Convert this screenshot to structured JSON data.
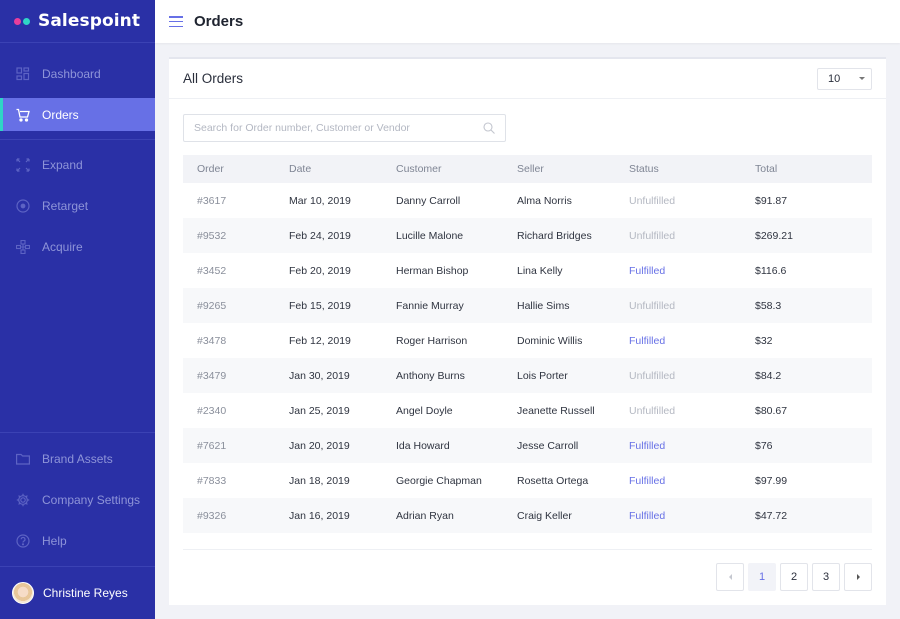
{
  "app": {
    "name": "Salespoint",
    "logo_dot_colors": [
      "#e83e9c",
      "#2fd5c6"
    ]
  },
  "colors": {
    "sidebar_bg": "#2a30a6",
    "accent": "#6770e6",
    "active_indicator": "#2fd5c6",
    "fulfilled": "#6770e6",
    "unfulfilled": "#b4b8c2"
  },
  "sidebar": {
    "top_items": [
      {
        "label": "Dashboard",
        "icon": "grid-icon",
        "active": false
      },
      {
        "label": "Orders",
        "icon": "cart-icon",
        "active": true
      }
    ],
    "mid_items": [
      {
        "label": "Expand",
        "icon": "expand-icon"
      },
      {
        "label": "Retarget",
        "icon": "target-icon"
      },
      {
        "label": "Acquire",
        "icon": "network-icon"
      }
    ],
    "bottom_items": [
      {
        "label": "Brand Assets",
        "icon": "folder-icon"
      },
      {
        "label": "Company Settings",
        "icon": "gear-icon"
      },
      {
        "label": "Help",
        "icon": "help-icon"
      }
    ],
    "user": {
      "name": "Christine Reyes"
    }
  },
  "header": {
    "title": "Orders"
  },
  "card": {
    "title": "All Orders",
    "page_size": "10",
    "search_placeholder": "Search for Order number, Customer or Vendor",
    "search_value": ""
  },
  "table": {
    "columns": [
      "Order",
      "Date",
      "Customer",
      "Seller",
      "Status",
      "Total"
    ],
    "rows": [
      {
        "order": "#3617",
        "date": "Mar 10, 2019",
        "customer": "Danny Carroll",
        "seller": "Alma Norris",
        "status": "Unfulfilled",
        "total": "$91.87"
      },
      {
        "order": "#9532",
        "date": "Feb 24, 2019",
        "customer": "Lucille Malone",
        "seller": "Richard Bridges",
        "status": "Unfulfilled",
        "total": "$269.21"
      },
      {
        "order": "#3452",
        "date": "Feb 20, 2019",
        "customer": "Herman Bishop",
        "seller": "Lina Kelly",
        "status": "Fulfilled",
        "total": "$116.6"
      },
      {
        "order": "#9265",
        "date": "Feb 15, 2019",
        "customer": "Fannie Murray",
        "seller": "Hallie Sims",
        "status": "Unfulfilled",
        "total": "$58.3"
      },
      {
        "order": "#3478",
        "date": "Feb 12, 2019",
        "customer": "Roger Harrison",
        "seller": "Dominic Willis",
        "status": "Fulfilled",
        "total": "$32"
      },
      {
        "order": "#3479",
        "date": "Jan 30, 2019",
        "customer": "Anthony Burns",
        "seller": "Lois Porter",
        "status": "Unfulfilled",
        "total": "$84.2"
      },
      {
        "order": "#2340",
        "date": "Jan 25, 2019",
        "customer": "Angel Doyle",
        "seller": "Jeanette Russell",
        "status": "Unfulfilled",
        "total": "$80.67"
      },
      {
        "order": "#7621",
        "date": "Jan 20, 2019",
        "customer": "Ida Howard",
        "seller": "Jesse Carroll",
        "status": "Fulfilled",
        "total": "$76"
      },
      {
        "order": "#7833",
        "date": "Jan 18, 2019",
        "customer": "Georgie Chapman",
        "seller": "Rosetta Ortega",
        "status": "Fulfilled",
        "total": "$97.99"
      },
      {
        "order": "#9326",
        "date": "Jan 16, 2019",
        "customer": "Adrian Ryan",
        "seller": "Craig Keller",
        "status": "Fulfilled",
        "total": "$47.72"
      }
    ]
  },
  "pagination": {
    "pages": [
      "1",
      "2",
      "3"
    ],
    "current": "1"
  }
}
